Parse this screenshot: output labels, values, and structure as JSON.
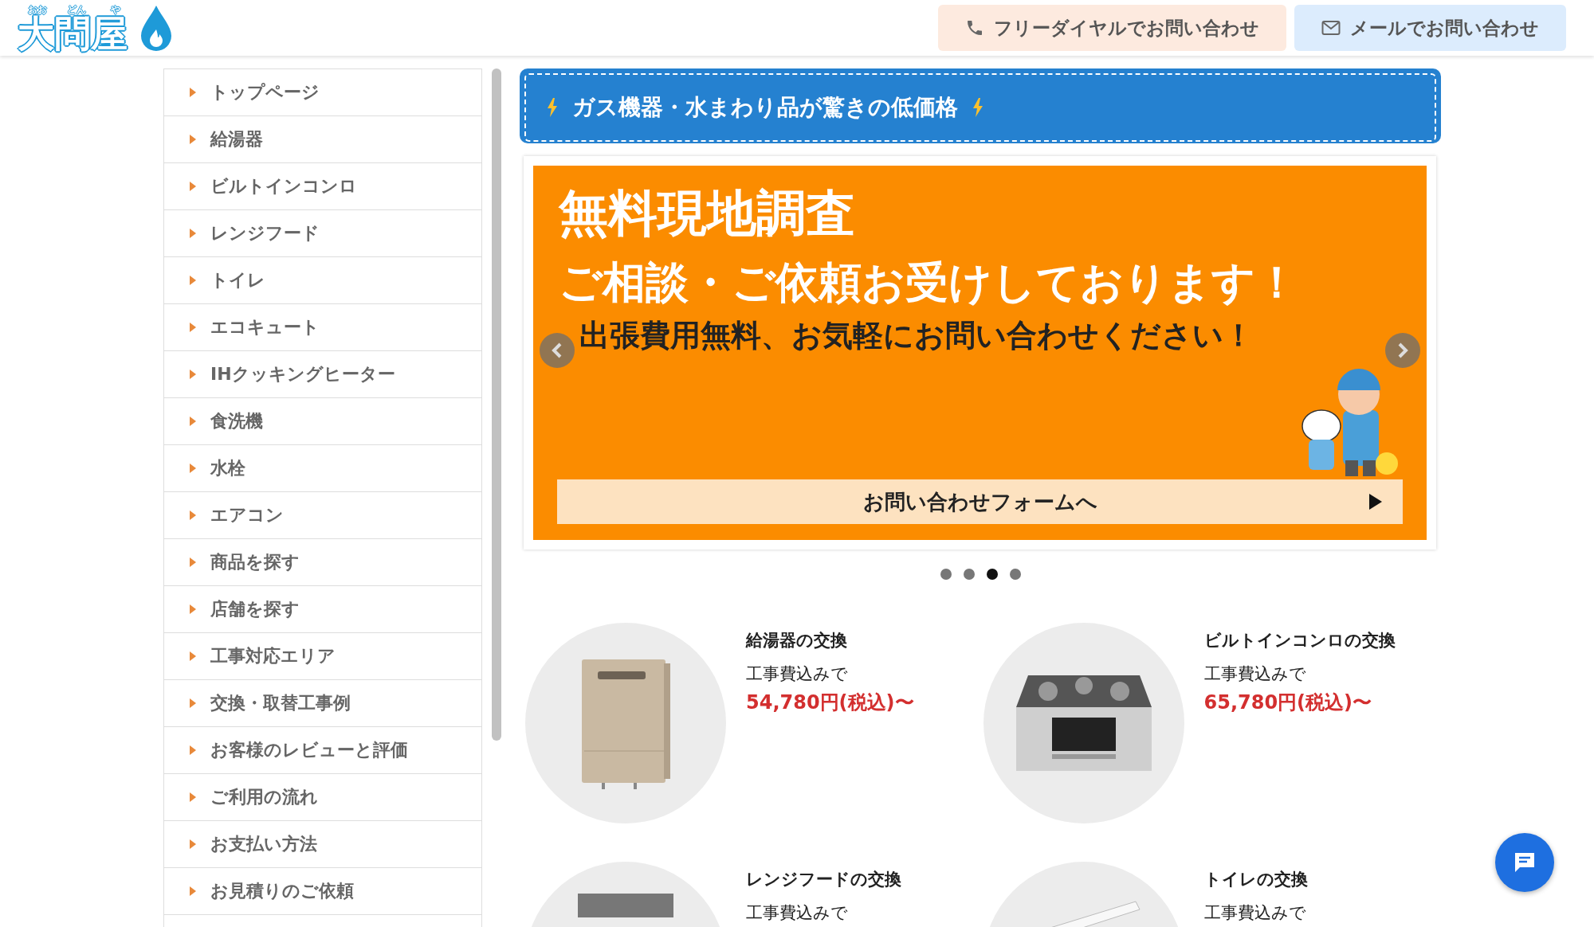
{
  "logo": {
    "text": "大問屋",
    "furigana": [
      "おお",
      "どん",
      "や"
    ]
  },
  "header_buttons": [
    {
      "kind": "phone",
      "label": "フリーダイヤルでお問い合わせ"
    },
    {
      "kind": "mail",
      "label": "メールでお問い合わせ"
    }
  ],
  "sidebar": {
    "items": [
      "トップページ",
      "給湯器",
      "ビルトインコンロ",
      "レンジフード",
      "トイレ",
      "エコキュート",
      "IHクッキングヒーター",
      "食洗機",
      "水栓",
      "エアコン",
      "商品を探す",
      "店舗を探す",
      "工事対応エリア",
      "交換・取替工事例",
      "お客様のレビューと評価",
      "ご利用の流れ",
      "お支払い方法",
      "お見積りのご依頼"
    ]
  },
  "promo_bar": {
    "text": "ガス機器・水まわり品が驚きの低価格"
  },
  "slider": {
    "headline": "無料現地調査",
    "subheadline": "ご相談・ご依頼お受けしております！",
    "note": "出張費用無料、お気軽にお問い合わせください！",
    "cta": "お問い合わせフォームへ",
    "dots": [
      {
        "selected": false
      },
      {
        "selected": false
      },
      {
        "selected": true
      },
      {
        "selected": false
      }
    ]
  },
  "products": [
    {
      "kind": "water-heater",
      "title": "給湯器の交換",
      "note": "工事費込みで",
      "price": "54,780円(税込)〜"
    },
    {
      "kind": "cooktop",
      "title": "ビルトインコンロの交換",
      "note": "工事費込みで",
      "price": "65,780円(税込)〜"
    },
    {
      "kind": "range-hood",
      "title": "レンジフードの交換",
      "note": "工事費込みで"
    },
    {
      "kind": "toilet",
      "title": "トイレの交換",
      "note": "工事費込みで"
    }
  ]
}
